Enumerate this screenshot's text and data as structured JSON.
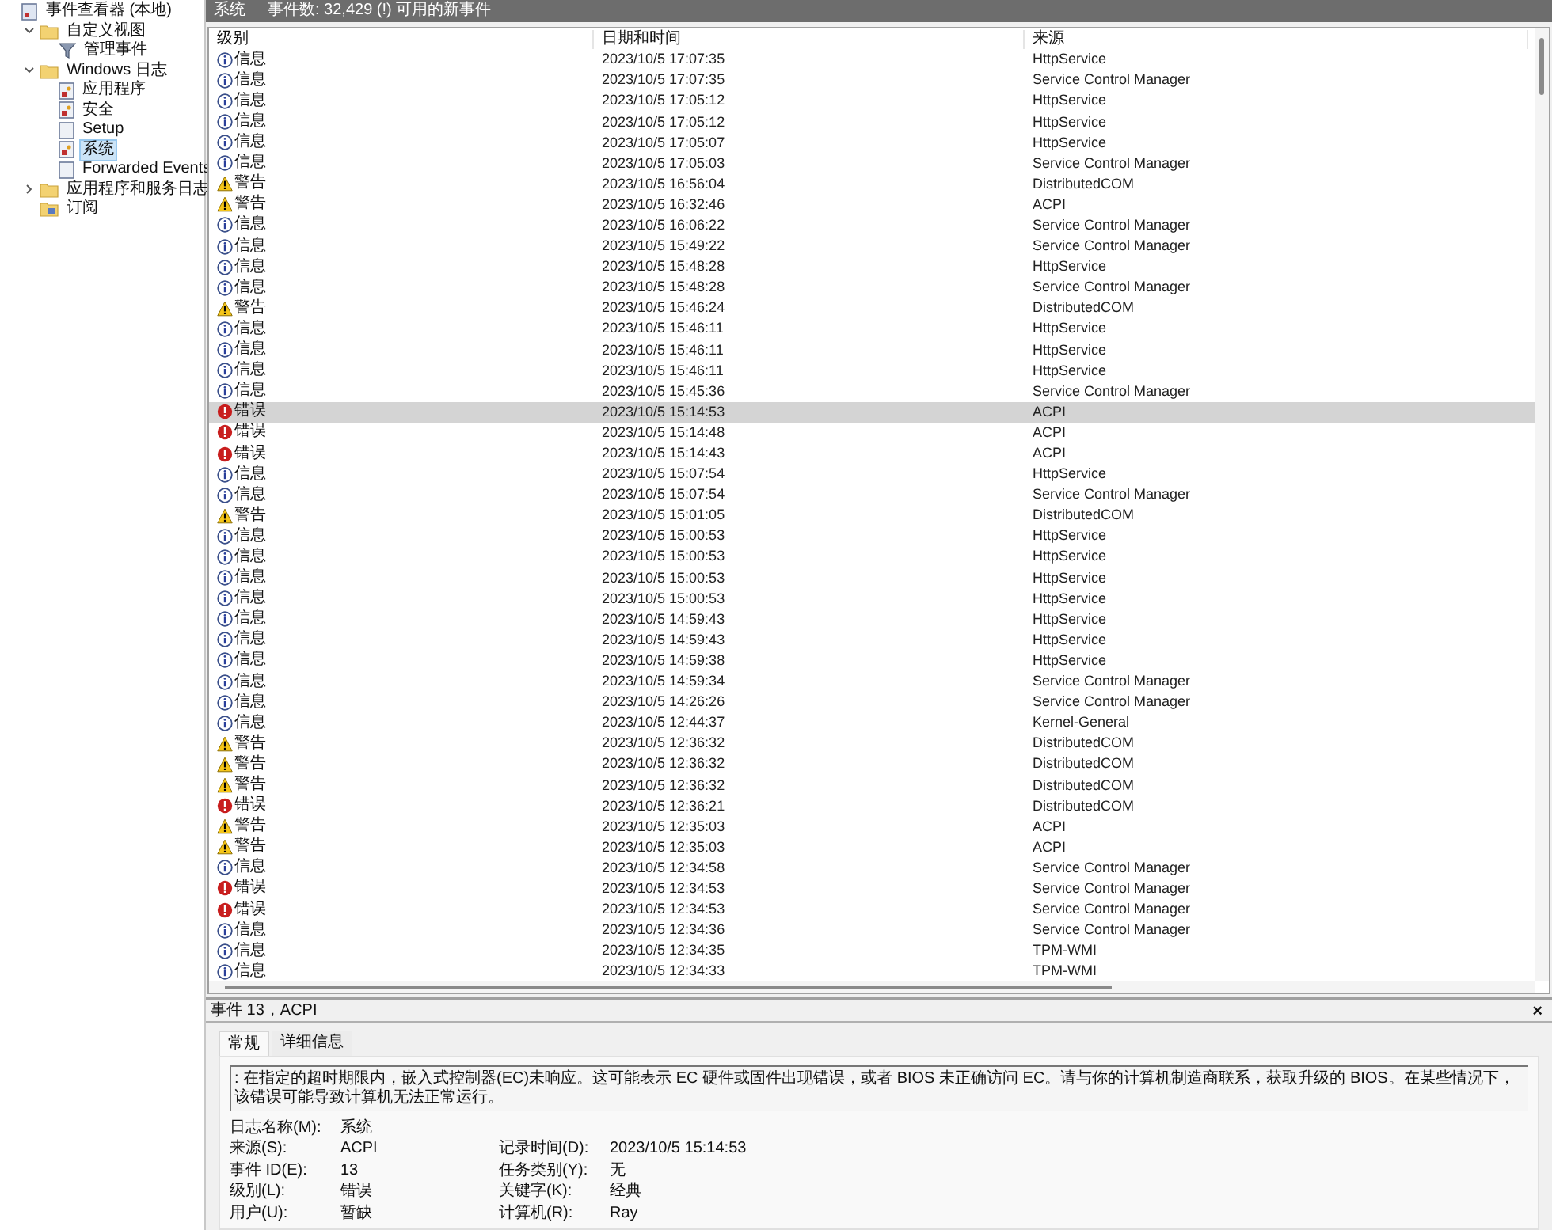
{
  "tree": [
    {
      "label": "事件查看器 (本地)",
      "kind": "viewer",
      "selected": false,
      "children": [
        {
          "label": "自定义视图",
          "kind": "folder",
          "expanded": true,
          "selected": false,
          "children": [
            {
              "label": "管理事件",
              "kind": "filter",
              "selected": false
            }
          ]
        },
        {
          "label": "Windows 日志",
          "kind": "folder",
          "expanded": true,
          "selected": false,
          "children": [
            {
              "label": "应用程序",
              "kind": "log",
              "selected": false
            },
            {
              "label": "安全",
              "kind": "log",
              "selected": false
            },
            {
              "label": "Setup",
              "kind": "plainlog",
              "selected": false
            },
            {
              "label": "系统",
              "kind": "log",
              "selected": true
            },
            {
              "label": "Forwarded Events",
              "kind": "plainlog",
              "selected": false
            }
          ]
        },
        {
          "label": "应用程序和服务日志",
          "kind": "folder",
          "expanded": false,
          "selected": false
        },
        {
          "label": "订阅",
          "kind": "subscription",
          "selected": false
        }
      ]
    }
  ],
  "header": {
    "title": "系统",
    "summary": "事件数: 32,429 (!) 可用的新事件"
  },
  "table": {
    "columns": [
      "级别",
      "日期和时间",
      "来源"
    ],
    "rows": [
      {
        "kind": "info",
        "level": "信息",
        "time": "2023/10/5 17:07:35",
        "source": "HttpService",
        "selected": false
      },
      {
        "kind": "info",
        "level": "信息",
        "time": "2023/10/5 17:07:35",
        "source": "Service Control Manager",
        "selected": false
      },
      {
        "kind": "info",
        "level": "信息",
        "time": "2023/10/5 17:05:12",
        "source": "HttpService",
        "selected": false
      },
      {
        "kind": "info",
        "level": "信息",
        "time": "2023/10/5 17:05:12",
        "source": "HttpService",
        "selected": false
      },
      {
        "kind": "info",
        "level": "信息",
        "time": "2023/10/5 17:05:07",
        "source": "HttpService",
        "selected": false
      },
      {
        "kind": "info",
        "level": "信息",
        "time": "2023/10/5 17:05:03",
        "source": "Service Control Manager",
        "selected": false
      },
      {
        "kind": "warning",
        "level": "警告",
        "time": "2023/10/5 16:56:04",
        "source": "DistributedCOM",
        "selected": false
      },
      {
        "kind": "warning",
        "level": "警告",
        "time": "2023/10/5 16:32:46",
        "source": "ACPI",
        "selected": false
      },
      {
        "kind": "info",
        "level": "信息",
        "time": "2023/10/5 16:06:22",
        "source": "Service Control Manager",
        "selected": false
      },
      {
        "kind": "info",
        "level": "信息",
        "time": "2023/10/5 15:49:22",
        "source": "Service Control Manager",
        "selected": false
      },
      {
        "kind": "info",
        "level": "信息",
        "time": "2023/10/5 15:48:28",
        "source": "HttpService",
        "selected": false
      },
      {
        "kind": "info",
        "level": "信息",
        "time": "2023/10/5 15:48:28",
        "source": "Service Control Manager",
        "selected": false
      },
      {
        "kind": "warning",
        "level": "警告",
        "time": "2023/10/5 15:46:24",
        "source": "DistributedCOM",
        "selected": false
      },
      {
        "kind": "info",
        "level": "信息",
        "time": "2023/10/5 15:46:11",
        "source": "HttpService",
        "selected": false
      },
      {
        "kind": "info",
        "level": "信息",
        "time": "2023/10/5 15:46:11",
        "source": "HttpService",
        "selected": false
      },
      {
        "kind": "info",
        "level": "信息",
        "time": "2023/10/5 15:46:11",
        "source": "HttpService",
        "selected": false
      },
      {
        "kind": "info",
        "level": "信息",
        "time": "2023/10/5 15:45:36",
        "source": "Service Control Manager",
        "selected": false
      },
      {
        "kind": "error",
        "level": "错误",
        "time": "2023/10/5 15:14:53",
        "source": "ACPI",
        "selected": true
      },
      {
        "kind": "error",
        "level": "错误",
        "time": "2023/10/5 15:14:48",
        "source": "ACPI",
        "selected": false
      },
      {
        "kind": "error",
        "level": "错误",
        "time": "2023/10/5 15:14:43",
        "source": "ACPI",
        "selected": false
      },
      {
        "kind": "info",
        "level": "信息",
        "time": "2023/10/5 15:07:54",
        "source": "HttpService",
        "selected": false
      },
      {
        "kind": "info",
        "level": "信息",
        "time": "2023/10/5 15:07:54",
        "source": "Service Control Manager",
        "selected": false
      },
      {
        "kind": "warning",
        "level": "警告",
        "time": "2023/10/5 15:01:05",
        "source": "DistributedCOM",
        "selected": false
      },
      {
        "kind": "info",
        "level": "信息",
        "time": "2023/10/5 15:00:53",
        "source": "HttpService",
        "selected": false
      },
      {
        "kind": "info",
        "level": "信息",
        "time": "2023/10/5 15:00:53",
        "source": "HttpService",
        "selected": false
      },
      {
        "kind": "info",
        "level": "信息",
        "time": "2023/10/5 15:00:53",
        "source": "HttpService",
        "selected": false
      },
      {
        "kind": "info",
        "level": "信息",
        "time": "2023/10/5 15:00:53",
        "source": "HttpService",
        "selected": false
      },
      {
        "kind": "info",
        "level": "信息",
        "time": "2023/10/5 14:59:43",
        "source": "HttpService",
        "selected": false
      },
      {
        "kind": "info",
        "level": "信息",
        "time": "2023/10/5 14:59:43",
        "source": "HttpService",
        "selected": false
      },
      {
        "kind": "info",
        "level": "信息",
        "time": "2023/10/5 14:59:38",
        "source": "HttpService",
        "selected": false
      },
      {
        "kind": "info",
        "level": "信息",
        "time": "2023/10/5 14:59:34",
        "source": "Service Control Manager",
        "selected": false
      },
      {
        "kind": "info",
        "level": "信息",
        "time": "2023/10/5 14:26:26",
        "source": "Service Control Manager",
        "selected": false
      },
      {
        "kind": "info",
        "level": "信息",
        "time": "2023/10/5 12:44:37",
        "source": "Kernel-General",
        "selected": false
      },
      {
        "kind": "warning",
        "level": "警告",
        "time": "2023/10/5 12:36:32",
        "source": "DistributedCOM",
        "selected": false
      },
      {
        "kind": "warning",
        "level": "警告",
        "time": "2023/10/5 12:36:32",
        "source": "DistributedCOM",
        "selected": false
      },
      {
        "kind": "warning",
        "level": "警告",
        "time": "2023/10/5 12:36:32",
        "source": "DistributedCOM",
        "selected": false
      },
      {
        "kind": "error",
        "level": "错误",
        "time": "2023/10/5 12:36:21",
        "source": "DistributedCOM",
        "selected": false
      },
      {
        "kind": "warning",
        "level": "警告",
        "time": "2023/10/5 12:35:03",
        "source": "ACPI",
        "selected": false
      },
      {
        "kind": "warning",
        "level": "警告",
        "time": "2023/10/5 12:35:03",
        "source": "ACPI",
        "selected": false
      },
      {
        "kind": "info",
        "level": "信息",
        "time": "2023/10/5 12:34:58",
        "source": "Service Control Manager",
        "selected": false
      },
      {
        "kind": "error",
        "level": "错误",
        "time": "2023/10/5 12:34:53",
        "source": "Service Control Manager",
        "selected": false
      },
      {
        "kind": "error",
        "level": "错误",
        "time": "2023/10/5 12:34:53",
        "source": "Service Control Manager",
        "selected": false
      },
      {
        "kind": "info",
        "level": "信息",
        "time": "2023/10/5 12:34:36",
        "source": "Service Control Manager",
        "selected": false
      },
      {
        "kind": "info",
        "level": "信息",
        "time": "2023/10/5 12:34:35",
        "source": "TPM-WMI",
        "selected": false
      },
      {
        "kind": "info",
        "level": "信息",
        "time": "2023/10/5 12:34:33",
        "source": "TPM-WMI",
        "selected": false
      }
    ]
  },
  "details": {
    "title": "事件 13，ACPI",
    "close": "×",
    "tabs": [
      {
        "label": "常规",
        "selected": true
      },
      {
        "label": "详细信息",
        "selected": false
      }
    ],
    "message": ": 在指定的超时期限内，嵌入式控制器(EC)未响应。这可能表示 EC 硬件或固件出现错误，或者 BIOS 未正确访问 EC。请与你的计算机制造商联系，获取升级的 BIOS。在某些情况下，该错误可能导致计算机无法正常运行。",
    "fields": [
      [
        {
          "label": "日志名称(M):",
          "value": "系统"
        }
      ],
      [
        {
          "label": "来源(S):",
          "value": "ACPI"
        },
        {
          "label": "记录时间(D):",
          "value": "2023/10/5 15:14:53"
        }
      ],
      [
        {
          "label": "事件 ID(E):",
          "value": "13"
        },
        {
          "label": "任务类别(Y):",
          "value": "无"
        }
      ],
      [
        {
          "label": "级别(L):",
          "value": "错误"
        },
        {
          "label": "关键字(K):",
          "value": "经典"
        }
      ],
      [
        {
          "label": "用户(U):",
          "value": "暂缺"
        },
        {
          "label": "计算机(R):",
          "value": "Ray"
        }
      ]
    ]
  }
}
